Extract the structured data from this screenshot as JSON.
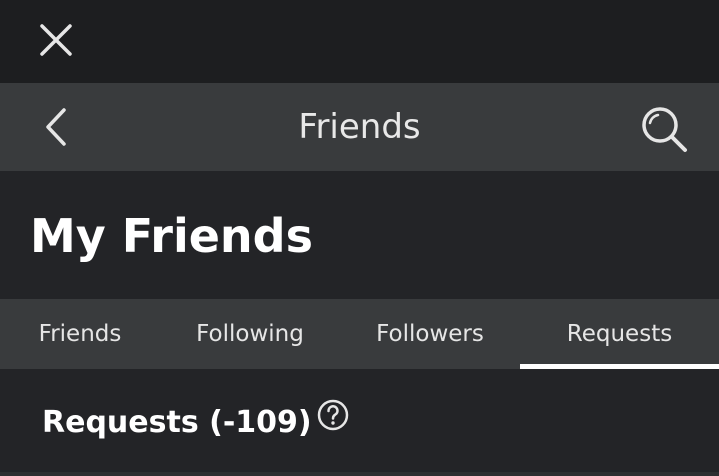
{
  "header": {
    "title": "Friends"
  },
  "page": {
    "title": "My Friends"
  },
  "tabs": [
    {
      "label": "Friends",
      "active": false
    },
    {
      "label": "Following",
      "active": false
    },
    {
      "label": "Followers",
      "active": false
    },
    {
      "label": "Requests",
      "active": true
    }
  ],
  "section": {
    "title": "Requests (-109)"
  },
  "icons": {
    "close": "close-icon",
    "back": "chevron-left-icon",
    "search": "search-icon",
    "help": "help-circle-icon"
  },
  "colors": {
    "background": "#232427",
    "topbar": "#1d1e20",
    "header": "#393b3d",
    "text": "#ffffff",
    "active_indicator": "#ffffff"
  }
}
